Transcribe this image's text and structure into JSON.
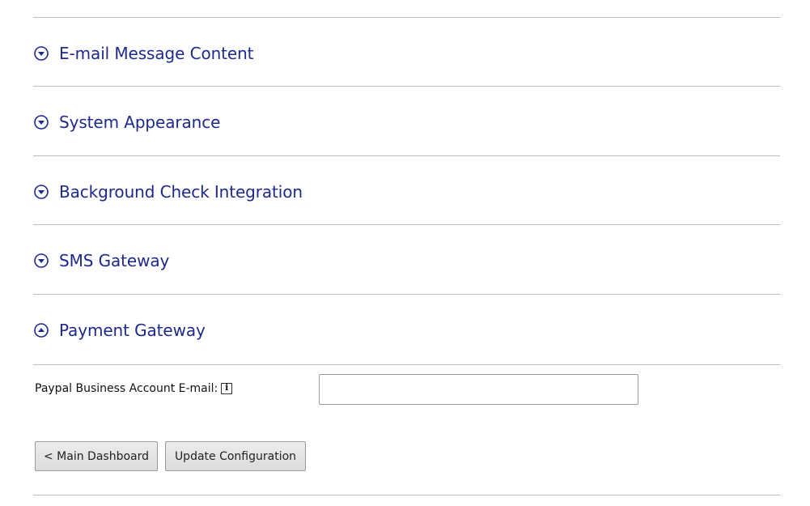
{
  "sections": [
    {
      "title": "E-mail Message Content",
      "state": "collapsed",
      "icon": "chevron-down-icon"
    },
    {
      "title": "System Appearance",
      "state": "collapsed",
      "icon": "chevron-down-icon"
    },
    {
      "title": "Background Check Integration",
      "state": "collapsed",
      "icon": "chevron-down-icon"
    },
    {
      "title": "SMS Gateway",
      "state": "collapsed",
      "icon": "chevron-down-icon"
    },
    {
      "title": "Payment Gateway",
      "state": "expanded",
      "icon": "chevron-up-icon"
    }
  ],
  "payment_gateway": {
    "paypal_label": "Paypal Business Account E-mail:",
    "paypal_value": "",
    "paypal_placeholder": "",
    "info_glyph": "i"
  },
  "actions": {
    "main_dashboard_label": "< Main Dashboard",
    "update_label": "Update Configuration"
  },
  "colors": {
    "section_title": "#1d2a8c",
    "icon_ring": "#1d2a8c",
    "rule": "#bdbdbd"
  }
}
